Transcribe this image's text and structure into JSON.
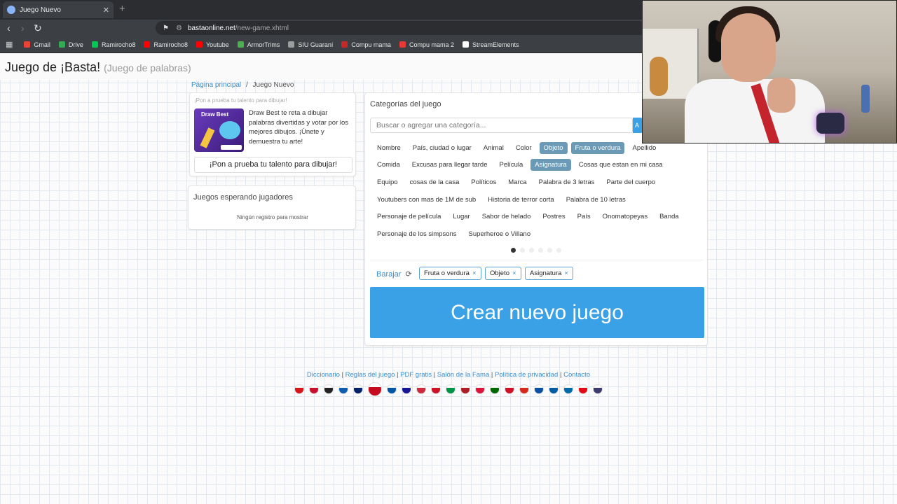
{
  "browser": {
    "tab_title": "Juego Nuevo",
    "url_domain": "bastaonline.net",
    "url_path": "/new-game.xhtml",
    "bookmarks": [
      {
        "label": "Gmail",
        "color": "#ea4335"
      },
      {
        "label": "Drive",
        "color": "#34a853"
      },
      {
        "label": "Ramirocho8",
        "color": "#00c853"
      },
      {
        "label": "Ramirocho8",
        "color": "#ff0000"
      },
      {
        "label": "Youtube",
        "color": "#ff0000"
      },
      {
        "label": "ArmorTrims",
        "color": "#4caf50"
      },
      {
        "label": "SIU Guaraní",
        "color": "#9e9e9e"
      },
      {
        "label": "Compu mama",
        "color": "#c62828"
      },
      {
        "label": "Compu mama 2",
        "color": "#e53935"
      },
      {
        "label": "StreamElements",
        "color": "#ffffff"
      }
    ]
  },
  "site": {
    "title": "Juego de ¡Basta!",
    "subtitle": "(Juego de palabras)"
  },
  "breadcrumb": {
    "home": "Página principal",
    "sep": "/",
    "current": "Juego Nuevo"
  },
  "promo": {
    "caption": "¡Pon a prueba tu talento para dibujar!",
    "image_title": "Draw Best",
    "text": "Draw Best te reta a dibujar palabras divertidas y votar por los mejores dibujos. ¡Únete y demuestra tu arte!",
    "button": "¡Pon a prueba tu talento para dibujar!"
  },
  "waiting": {
    "title": "Juegos esperando jugadores",
    "empty": "Ningún registro para mostrar"
  },
  "categories": {
    "title": "Categorías del juego",
    "search_placeholder": "Buscar o agregar una categoría...",
    "add_label": "A",
    "rows": [
      [
        {
          "label": "Nombre",
          "selected": false
        },
        {
          "label": "País, ciudad o lugar",
          "selected": false
        },
        {
          "label": "Animal",
          "selected": false
        },
        {
          "label": "Color",
          "selected": false
        },
        {
          "label": "Objeto",
          "selected": true
        },
        {
          "label": "Fruta o verdura",
          "selected": true
        },
        {
          "label": "Apellido",
          "selected": false
        }
      ],
      [
        {
          "label": "Comida",
          "selected": false
        },
        {
          "label": "Excusas para llegar tarde",
          "selected": false
        },
        {
          "label": "Película",
          "selected": false
        },
        {
          "label": "Asignatura",
          "selected": true
        },
        {
          "label": "Cosas que estan en mi casa",
          "selected": false
        }
      ],
      [
        {
          "label": "Equipo",
          "selected": false
        },
        {
          "label": "cosas de la casa",
          "selected": false
        },
        {
          "label": "Políticos",
          "selected": false
        },
        {
          "label": "Marca",
          "selected": false
        },
        {
          "label": "Palabra de 3 letras",
          "selected": false
        },
        {
          "label": "Parte del cuerpo",
          "selected": false
        }
      ],
      [
        {
          "label": "Youtubers con mas de 1M de sub",
          "selected": false
        },
        {
          "label": "Historia de terror corta",
          "selected": false
        },
        {
          "label": "Palabra de 10 letras",
          "selected": false
        }
      ],
      [
        {
          "label": "Personaje de película",
          "selected": false
        },
        {
          "label": "Lugar",
          "selected": false
        },
        {
          "label": "Sabor de helado",
          "selected": false
        },
        {
          "label": "Postres",
          "selected": false
        },
        {
          "label": "País",
          "selected": false
        },
        {
          "label": "Onomatopeyas",
          "selected": false
        },
        {
          "label": "Banda",
          "selected": false
        }
      ],
      [
        {
          "label": "Personaje de los simpsons",
          "selected": false
        },
        {
          "label": "Superheroe o Villano",
          "selected": false
        }
      ]
    ],
    "pages_total": 6,
    "page_current": 1,
    "shuffle_label": "Barajar",
    "selected_tags": [
      "Fruta o verdura",
      "Objeto",
      "Asignatura"
    ],
    "remove_glyph": "×"
  },
  "create_button": "Crear nuevo juego",
  "footer": {
    "links": [
      "Diccionario",
      "Reglas del juego",
      "PDF gratis",
      "Salón de la Fama",
      "Política de privacidad",
      "Contacto"
    ],
    "separator": " | ",
    "flags": [
      "#d7141a",
      "#c8102e",
      "#222222",
      "#0d5eaf",
      "#012169",
      "#c60b1e",
      "#0055a4",
      "#171796",
      "#cd2a3e",
      "#ce1126",
      "#009246",
      "#ae1c28",
      "#dc143c",
      "#006600",
      "#ce1126",
      "#d52b1e",
      "#0b4ea2",
      "#005da4",
      "#006aa7",
      "#e30a17",
      "#3c3b6e"
    ],
    "big_flag_index": 5
  },
  "colors": {
    "accent": "#3ba1e6",
    "chip_selected": "#6a9ab6",
    "link": "#3a8fd0"
  }
}
